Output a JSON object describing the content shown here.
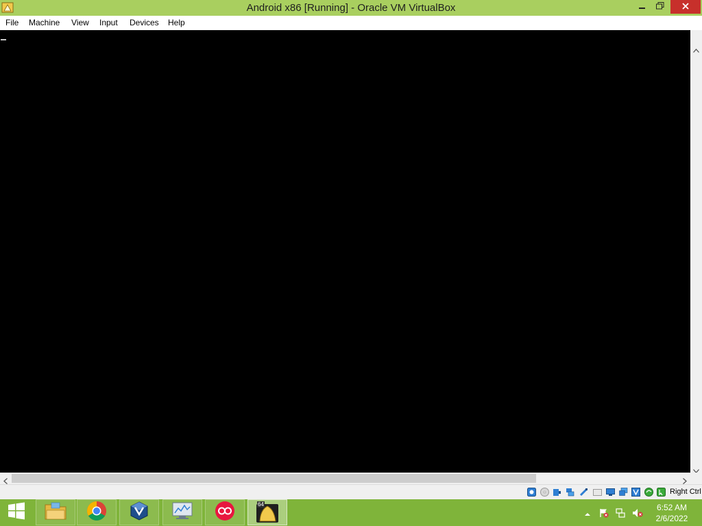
{
  "window": {
    "title": "Android x86 [Running] - Oracle VM VirtualBox",
    "app_icon": "virtualbox-app-icon",
    "controls": [
      "minimize-icon",
      "restore-icon",
      "close-icon"
    ],
    "close_color": "#c7302b",
    "accent_color": "#a9cf5f"
  },
  "menu": {
    "items": [
      "File",
      "Machine",
      "View",
      "Input",
      "Devices",
      "Help"
    ]
  },
  "guest_screen": {
    "background": "#000000",
    "cursor": "_"
  },
  "status_bar": {
    "icons": [
      "hard-disk-icon",
      "optical-drive-icon",
      "audio-icon",
      "network-icon",
      "usb-icon",
      "shared-folders-icon",
      "display-icon",
      "video-capture-icon",
      "virtualization-icon",
      "cpu-execution-icon",
      "mouse-integration-icon"
    ],
    "host_key": "Right Ctrl"
  },
  "taskbar": {
    "start_icon": "windows-start-icon",
    "apps": [
      "file-explorer-icon",
      "chrome-icon",
      "virtualbox-manager-icon",
      "resource-monitor-icon",
      "red-circles-app-icon",
      "android-vm-icon"
    ],
    "android_vm_badge": "64",
    "tray_icons": [
      "show-hidden-icons-icon",
      "action-center-flag-icon",
      "network-icon",
      "volume-muted-icon"
    ],
    "time": "6:52 AM",
    "date": "2/6/2022",
    "color": "#7fb43a"
  }
}
